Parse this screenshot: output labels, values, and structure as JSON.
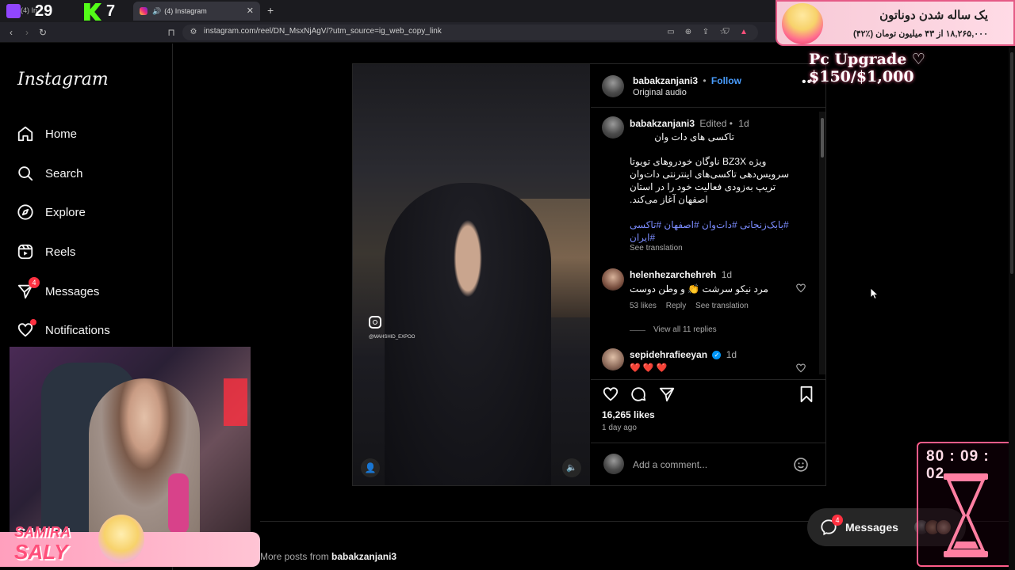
{
  "browser": {
    "stream_counter_left": "29",
    "stream_counter_right": "7",
    "inactive_tab_label": "(4) In",
    "tab_title": "(4) Instagram",
    "url": "instagram.com/reel/DN_MsxNjAgV/?utm_source=ig_web_copy_link"
  },
  "sidebar": {
    "logo": "Instagram",
    "items": [
      {
        "label": "Home",
        "icon": "home-icon"
      },
      {
        "label": "Search",
        "icon": "search-icon"
      },
      {
        "label": "Explore",
        "icon": "compass-icon"
      },
      {
        "label": "Reels",
        "icon": "reels-icon"
      },
      {
        "label": "Messages",
        "icon": "messenger-icon",
        "badge": "4"
      },
      {
        "label": "Notifications",
        "icon": "heart-icon"
      }
    ]
  },
  "post": {
    "author": "babakzanjani3",
    "follow": "Follow",
    "dot": "•",
    "audio": "Original audio",
    "video_watermark": "@MAHSHID_EXPOO",
    "caption": {
      "author": "babakzanjani3",
      "edited": "Edited •",
      "age": "1d",
      "title": "تاکسی های دات وان",
      "body_lines": [
        "ویژه BZ3X ناوگان خودروهای تویوتا",
        "سرویس‌دهی تاکسی‌های اینترنتی دات‌وان",
        "تریپ به‌زودی فعالیت خود را در استان",
        "اصفهان آغاز می‌کند."
      ],
      "hashtags_line1": "#بابک‌زنجانی #دات‌وان #اصفهان #تاکسی",
      "hashtags_line2": "#ایران",
      "see_translation": "See translation"
    },
    "comments": [
      {
        "user": "helenhezarchehreh",
        "age": "1d",
        "text": "مرد نیکو سرشت 👏 و وطن دوست",
        "likes": "53 likes",
        "reply": "Reply",
        "see_translation": "See translation",
        "view_replies": "View all 11 replies"
      },
      {
        "user": "sepidehrafieeyan",
        "verified": true,
        "age": "1d",
        "text": "❤️ ❤️ ❤️"
      }
    ],
    "likes": "16,265 likes",
    "time": "1 day ago",
    "comment_placeholder": "Add a comment..."
  },
  "more_posts": {
    "prefix": "More posts from",
    "user": "babakzanjani3"
  },
  "messages_pill": {
    "label": "Messages",
    "badge": "4"
  },
  "overlay": {
    "donation_title": "یک ساله شدن دوناتون",
    "donation_progress": "۱۸,۲۶۵,۰۰۰ از ۴۳ میلیون تومان (٪۴۲)",
    "goal": "Pc Upgrade ♡ $150/$1,000",
    "timer": "80 : 09 : 02",
    "streamer_name_line1": "SAMIRA",
    "streamer_name_line2": "SALY"
  },
  "colors": {
    "accent_blue": "#0095f6",
    "follow_blue": "#4a9eff",
    "badge_red": "#ff3040",
    "overlay_pink": "#ff5c8a"
  }
}
